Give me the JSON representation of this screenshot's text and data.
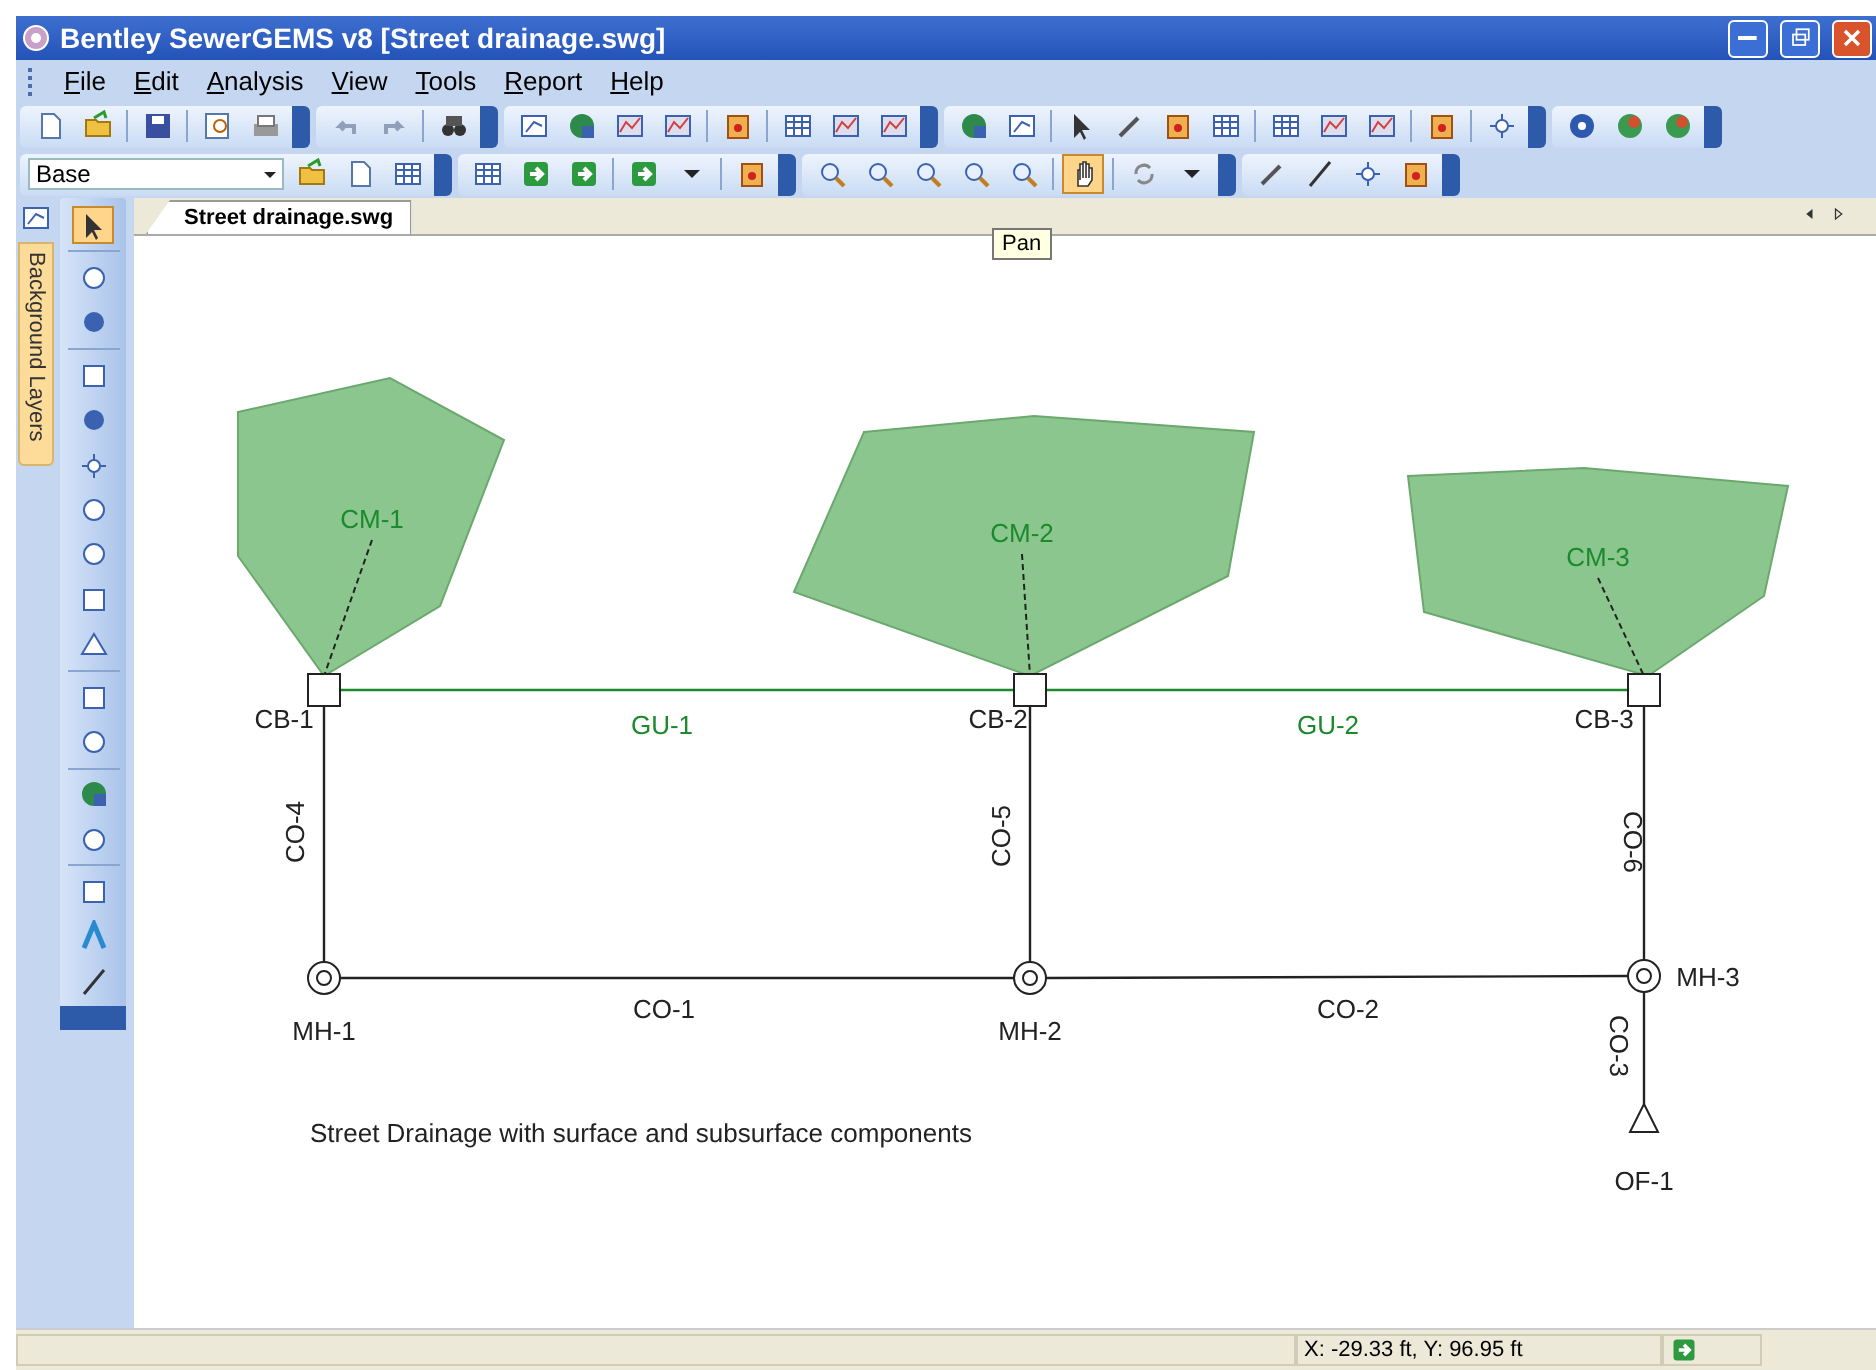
{
  "window": {
    "title": "Bentley SewerGEMS v8 [Street drainage.swg]"
  },
  "menu": [
    {
      "label": "File"
    },
    {
      "label": "Edit"
    },
    {
      "label": "Analysis"
    },
    {
      "label": "View"
    },
    {
      "label": "Tools"
    },
    {
      "label": "Report"
    },
    {
      "label": "Help"
    }
  ],
  "scenario_select": {
    "value": "Base"
  },
  "pan_button": {
    "selected": true
  },
  "tooltip": "Pan",
  "side_tab": {
    "label": "Background Layers"
  },
  "select_tool": {
    "selected": true
  },
  "document_tab": {
    "label": "Street drainage.swg",
    "selected": true
  },
  "drawing": {
    "catchments": [
      {
        "label": "CM-1"
      },
      {
        "label": "CM-2"
      },
      {
        "label": "CM-3"
      }
    ],
    "nodes": [
      {
        "label": "CB-1",
        "kind": "catch-basin"
      },
      {
        "label": "CB-2",
        "kind": "catch-basin"
      },
      {
        "label": "CB-3",
        "kind": "catch-basin"
      },
      {
        "label": "MH-1",
        "kind": "manhole"
      },
      {
        "label": "MH-2",
        "kind": "manhole"
      },
      {
        "label": "MH-3",
        "kind": "manhole"
      },
      {
        "label": "OF-1",
        "kind": "outfall"
      }
    ],
    "links": [
      {
        "label": "GU-1",
        "kind": "gutter"
      },
      {
        "label": "GU-2",
        "kind": "gutter"
      },
      {
        "label": "CO-4",
        "kind": "conduit"
      },
      {
        "label": "CO-5",
        "kind": "conduit"
      },
      {
        "label": "CO-6",
        "kind": "conduit"
      },
      {
        "label": "CO-1",
        "kind": "conduit"
      },
      {
        "label": "CO-2",
        "kind": "conduit"
      },
      {
        "label": "CO-3",
        "kind": "conduit"
      }
    ],
    "annotation": "Street Drainage with surface and subsurface components"
  },
  "status_bar": {
    "coordinates": "X: -29.33 ft, Y: 96.95 ft"
  }
}
